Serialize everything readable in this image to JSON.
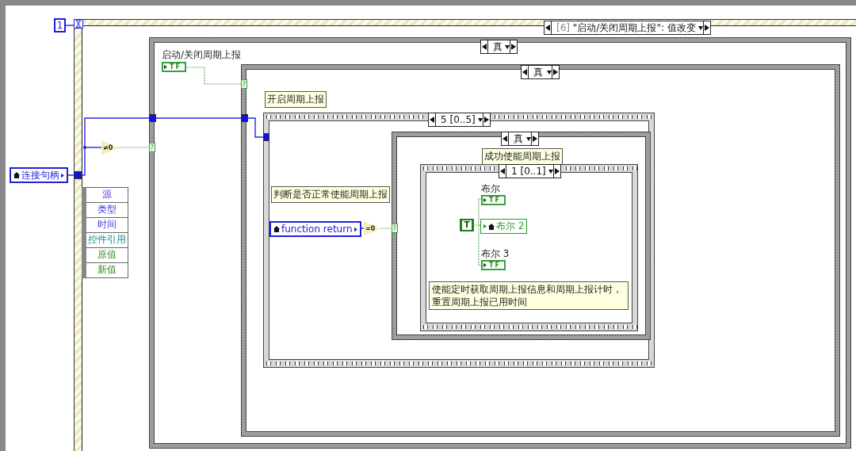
{
  "iteration_count": "1",
  "event_structure": {
    "selector_index": "[6]",
    "selector_event": "\"启动/关闭周期上报\": 值改变",
    "event_data": [
      "源",
      "类型",
      "时间",
      "控件引用",
      "原值",
      "新值"
    ],
    "handle_local": "连接句柄",
    "compare": "≠0",
    "selector_terminal": "?",
    "case": {
      "selector": "真",
      "control_label": "启动/关闭周期上报",
      "control_glyph": "TF",
      "selector_terminal": "?",
      "case": {
        "selector": "真",
        "comment": "开启周期上报",
        "sequence": {
          "selector": "5 [0..5]",
          "comment": "判断是否正常使能周期上报",
          "local": "function return",
          "compare": "=0",
          "selector_terminal": "?",
          "case": {
            "selector": "真",
            "comment": "成功使能周期上报",
            "sequence": {
              "selector": "1 [0..1]",
              "constant": "T",
              "indicators": [
                {
                  "kind": "terminal",
                  "label": "布尔",
                  "glyph": "TF"
                },
                {
                  "kind": "local",
                  "label": "布尔 2"
                },
                {
                  "kind": "terminal",
                  "label": "布尔 3",
                  "glyph": "TF"
                }
              ],
              "comment": "使能定时获取周期上报信息和周期上报计时，重置周期上报已用时间"
            }
          }
        }
      }
    }
  }
}
